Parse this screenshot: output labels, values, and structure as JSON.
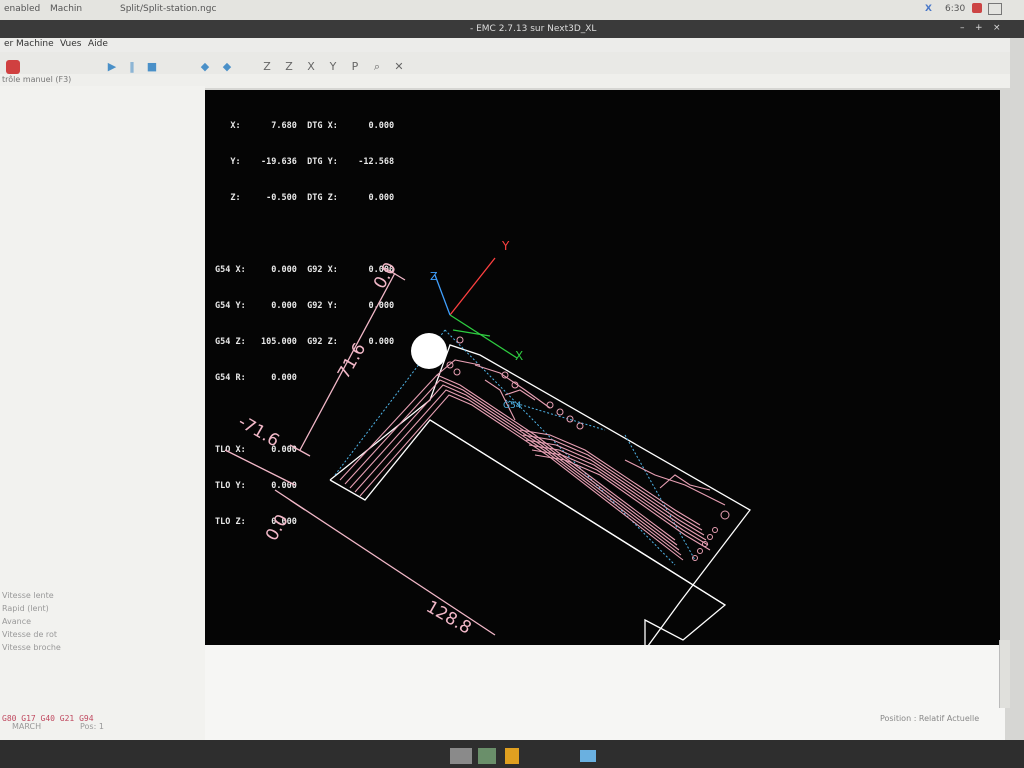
{
  "topbar": {
    "left_text": "enabled",
    "app2": "Machin",
    "app3": "Split/Split-station.ngc",
    "close_glyph": "X",
    "clock": "6:30"
  },
  "window": {
    "title": "- EMC 2.7.13 sur Next3D_XL"
  },
  "menu": [
    "er",
    "Machine",
    "Vues",
    "Aide"
  ],
  "toolbar": {
    "icons": [
      "power-icon",
      "play-icon",
      "pause-icon",
      "stop-icon",
      "step-icon",
      "jog-icon",
      "view-z-icon",
      "view-z2-icon",
      "view-x-icon",
      "view-y-icon",
      "view-p-icon",
      "zoom-icon",
      "rotate-icon"
    ],
    "letters": [
      "Z",
      "Z",
      "X",
      "Y",
      "P"
    ]
  },
  "tabs": {
    "manual": "trôle manuel (F3)"
  },
  "left_panel": {
    "labels": [
      "Vitesse lente",
      "Rapid (lent)",
      "Avance",
      "Vitesse de rot",
      "Vitesse broche"
    ],
    "gcode": "G80 G17 G40 G21 G94"
  },
  "dro": {
    "lines": [
      "   X:      7.680  DTG X:      0.000",
      "   Y:    -19.636  DTG Y:    -12.568",
      "   Z:     -0.500  DTG Z:      0.000",
      "",
      "G54 X:     0.000  G92 X:      0.000",
      "G54 Y:     0.000  G92 Y:      0.000",
      "G54 Z:   105.000  G92 Z:      0.000",
      "G54 R:     0.000",
      "",
      "TLO X:     0.000",
      "TLO Y:     0.000",
      "TLO Z:     0.000"
    ]
  },
  "plot": {
    "dim_labels": [
      "0.0",
      "71.6",
      "-71.6",
      "0.0",
      "128.8"
    ],
    "axis_labels": {
      "x": "X",
      "y": "Y",
      "z": "Z"
    },
    "g54_label": "G54",
    "colors": {
      "toolpath": "#e8a0b4",
      "dimensions": "#f2b8c8",
      "rapid": "#4fb4e8",
      "x_axis": "#2ecc40",
      "y_axis": "#ff4040",
      "z_axis": "#40a0ff",
      "outline": "#ffffff"
    }
  },
  "status": {
    "position": "Position : Relatif Actuelle",
    "mode": "MARCH",
    "line": "Pos: 1"
  }
}
